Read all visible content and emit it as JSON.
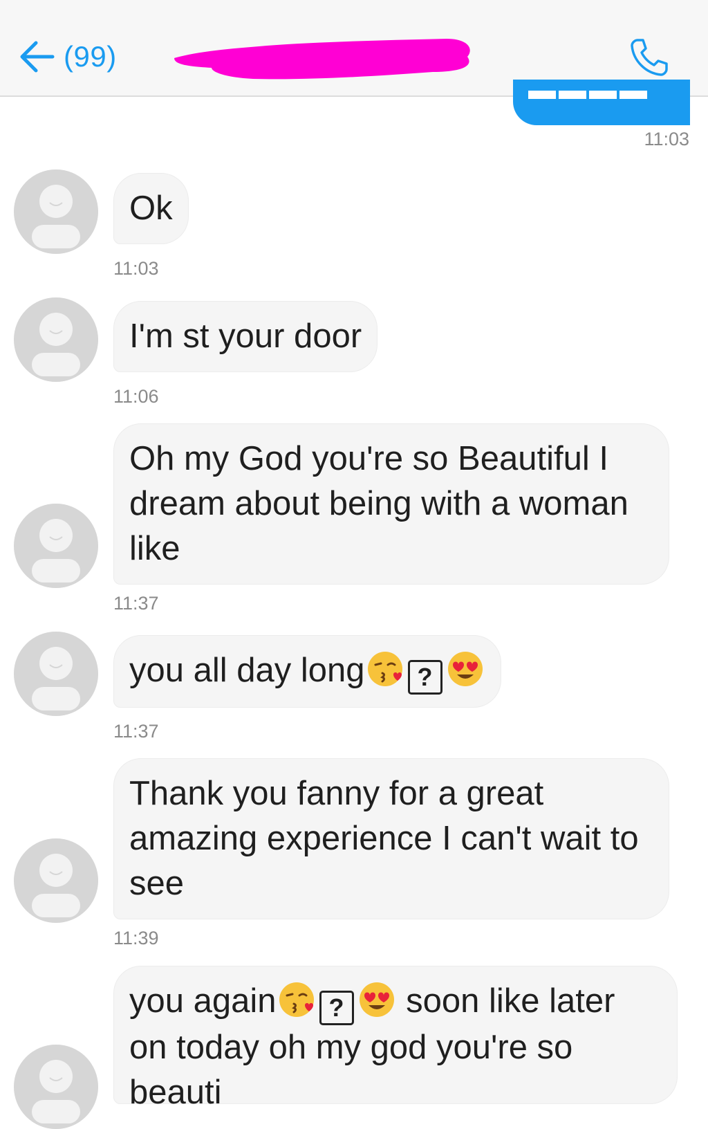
{
  "header": {
    "unread_count": "(99)",
    "contact_name_redacted": true
  },
  "sent": {
    "time": "11:03"
  },
  "messages": [
    {
      "text": "Ok",
      "time": "11:03"
    },
    {
      "text": "I'm st your door",
      "time": "11:06"
    },
    {
      "text": "Oh my God you're so Beautiful I dream about being with a woman like",
      "time": "11:37"
    },
    {
      "text": "you all day long",
      "time": "11:37",
      "emojis": [
        "kissing-heart-emoji",
        "unknown-glyph",
        "heart-eyes-emoji"
      ]
    },
    {
      "text": "Thank you fanny for a great amazing experience I can't wait to see",
      "time": "11:39"
    },
    {
      "text_before": "you again",
      "text_after": " soon like later on today oh my god you're so",
      "text_cut": "beauti",
      "emojis": [
        "kissing-heart-emoji",
        "unknown-glyph",
        "heart-eyes-emoji"
      ]
    }
  ],
  "colors": {
    "accent": "#1a9bf0",
    "redaction": "#ff00d4",
    "bubble_received": "#f5f5f5",
    "timestamp": "#8a8a8a"
  },
  "icons": [
    "back-arrow-icon",
    "phone-icon",
    "avatar-placeholder-icon"
  ]
}
